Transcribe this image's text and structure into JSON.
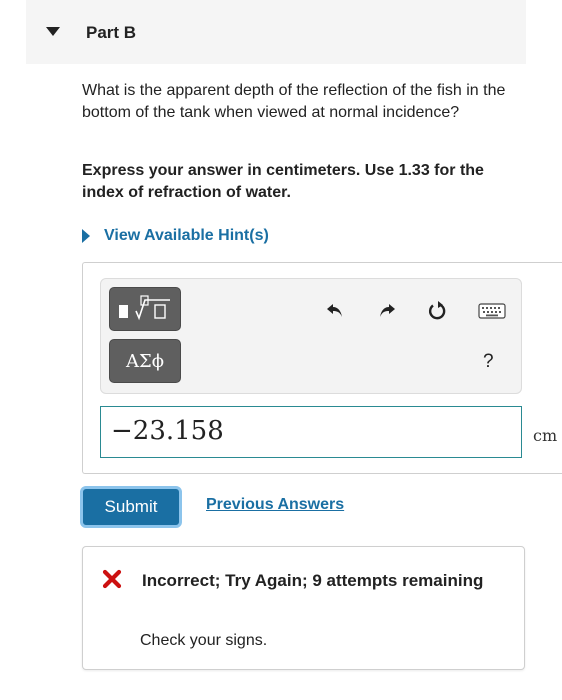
{
  "part": {
    "title": "Part B"
  },
  "question": {
    "text": "What is the apparent depth of the reflection of the fish in the bottom of the tank when viewed at normal incidence?",
    "instruction": "Express your answer in centimeters. Use 1.33 for the index of refraction of water."
  },
  "hint": {
    "label": "View Available Hint(s)"
  },
  "toolbar": {
    "template_button": "templates-icon",
    "greek_button_label": "ΑΣϕ",
    "icons": [
      "undo-icon",
      "redo-icon",
      "reset-icon",
      "keyboard-icon"
    ],
    "help_label": "?"
  },
  "answer": {
    "value": "−23.158",
    "unit": "cm"
  },
  "actions": {
    "submit_label": "Submit",
    "previous_answers_label": "Previous Answers"
  },
  "feedback": {
    "status_icon": "x-icon",
    "status_color": "#cc1111",
    "title": "Incorrect; Try Again; 9 attempts remaining",
    "message": "Check your signs."
  },
  "colors": {
    "accent": "#1a6fa3",
    "input_border": "#2a8a92"
  }
}
